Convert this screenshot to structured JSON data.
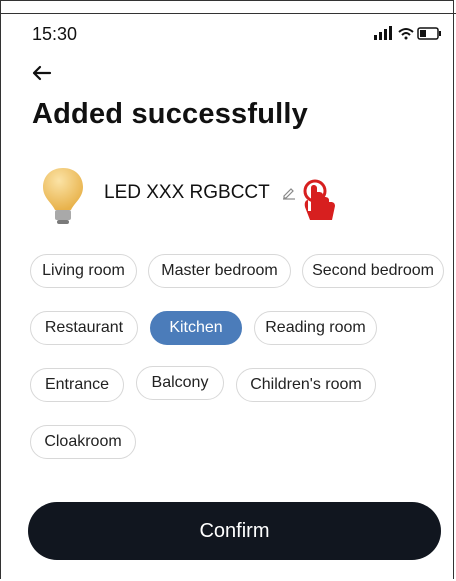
{
  "status": {
    "time": "15:30"
  },
  "header": {
    "title": "Added successfully"
  },
  "device": {
    "name": "LED XXX RGBCCT"
  },
  "rooms": [
    {
      "label": "Living room",
      "selected": false
    },
    {
      "label": "Master bedroom",
      "selected": false
    },
    {
      "label": "Second bedroom",
      "selected": false
    },
    {
      "label": "Restaurant",
      "selected": false
    },
    {
      "label": "Kitchen",
      "selected": true
    },
    {
      "label": "Reading room",
      "selected": false
    },
    {
      "label": "Entrance",
      "selected": false
    },
    {
      "label": "Balcony",
      "selected": false
    },
    {
      "label": "Children's room",
      "selected": false
    },
    {
      "label": "Cloakroom",
      "selected": false
    }
  ],
  "actions": {
    "confirm_label": "Confirm"
  },
  "colors": {
    "accent": "#4b7cba",
    "confirm_bg": "#11161f",
    "bulb": "#f2c14e",
    "tap": "#d71f1f"
  }
}
